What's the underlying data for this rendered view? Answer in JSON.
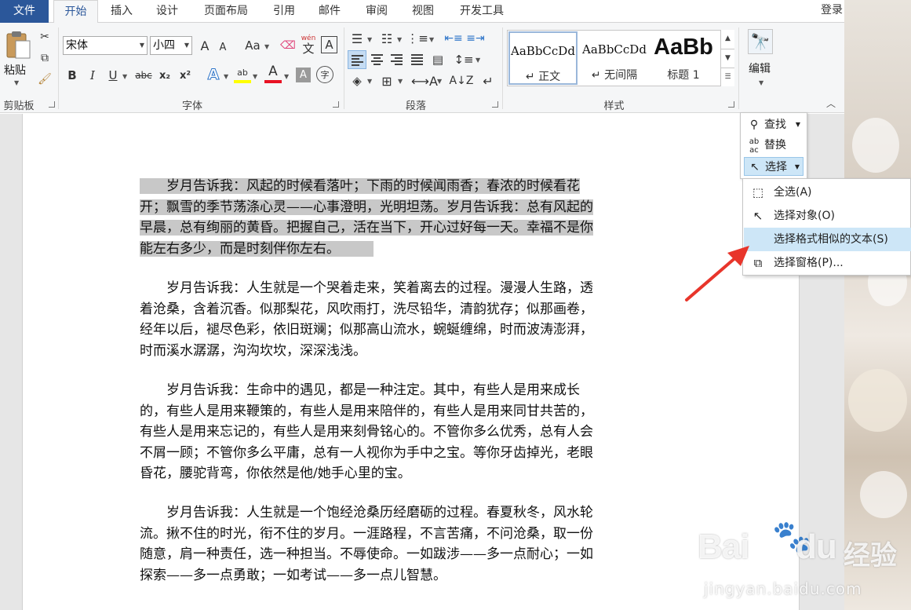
{
  "tabs": {
    "file": "文件",
    "items": [
      "开始",
      "插入",
      "设计",
      "页面布局",
      "引用",
      "邮件",
      "审阅",
      "视图",
      "开发工具"
    ],
    "login": "登录"
  },
  "ribbon": {
    "clipboard": {
      "paste": "粘贴",
      "label": "剪贴板"
    },
    "font": {
      "name": "宋体",
      "size": "小四",
      "grow": "A",
      "shrink": "A",
      "case": "Aa",
      "phonetic": "wén",
      "phonetic_char": "文",
      "border_char": "A",
      "bold": "B",
      "italic": "I",
      "underline": "U",
      "strike": "abc",
      "sub": "x₂",
      "sup": "x²",
      "effects": "A",
      "highlight": "ab",
      "color": "A",
      "shading": "A",
      "enclose": "字",
      "label": "字体",
      "highlight_color": "#ffff00",
      "font_color": "#e81123"
    },
    "paragraph": {
      "label": "段落"
    },
    "styles": {
      "items": [
        {
          "sample": "AaBbCcDd",
          "name": "↵ 正文"
        },
        {
          "sample": "AaBbCcDd",
          "name": "↵ 无间隔"
        },
        {
          "sample": "AaBb",
          "name": "标题 1"
        }
      ],
      "label": "样式"
    },
    "editing": {
      "label": "编辑"
    }
  },
  "edit_panel": {
    "find": "查找",
    "replace": "替换",
    "select": "选择"
  },
  "select_menu": {
    "items": [
      "全选(A)",
      "选择对象(O)",
      "选择格式相似的文本(S)",
      "选择窗格(P)..."
    ]
  },
  "document": {
    "p1": [
      "　　岁月告诉我：风起的时候看落叶；下雨的时候闻雨香；春浓的时候看花",
      "开；飘雪的季节荡涤心灵——心事澄明，光明坦荡。岁月告诉我：总有风起的",
      "早晨，总有绚丽的黄昏。把握自己，活在当下，开心过好每一天。幸福不是你",
      "能左右多少，而是时刻伴你左右。"
    ],
    "p2": [
      "　　岁月告诉我：人生就是一个哭着走来，笑着离去的过程。漫漫人生路，透",
      "着沧桑，含着沉香。似那梨花，风吹雨打，洗尽铅华，清韵犹存；似那画卷，",
      "经年以后，褪尽色彩，依旧斑斓；似那高山流水，蜿蜒缠绵，时而波涛澎湃，",
      "时而溪水潺潺，沟沟坎坎，深深浅浅。"
    ],
    "p3": [
      "　　岁月告诉我：生命中的遇见，都是一种注定。其中，有些人是用来成长",
      "的，有些人是用来鞭策的，有些人是用来陪伴的，有些人是用来同甘共苦的，",
      "有些人是用来忘记的，有些人是用来刻骨铭心的。不管你多么优秀，总有人会",
      "不屑一顾；不管你多么平庸，总有一人视你为手中之宝。等你牙齿掉光，老眼",
      "昏花，腰驼背弯，你依然是他/她手心里的宝。"
    ],
    "p4": [
      "　　岁月告诉我：人生就是一个饱经沧桑历经磨砺的过程。春夏秋冬，风水轮",
      "流。揪不住的时光，衔不住的岁月。一涯路程，不言苦痛，不问沧桑，取一份",
      "随意，肩一种责任，选一种担当。不辱使命。一如跋涉——多一点耐心；一如",
      "探索——多一点勇敢；一如考试——多一点儿智慧。"
    ]
  },
  "watermark": {
    "logo": "Bai",
    "logo2": "du",
    "jy": "经验",
    "url": "jingyan.baidu.com"
  },
  "colors": {
    "accent": "#2b579a",
    "arrow": "#e8352b",
    "menu_hot": "#cde6f7"
  }
}
